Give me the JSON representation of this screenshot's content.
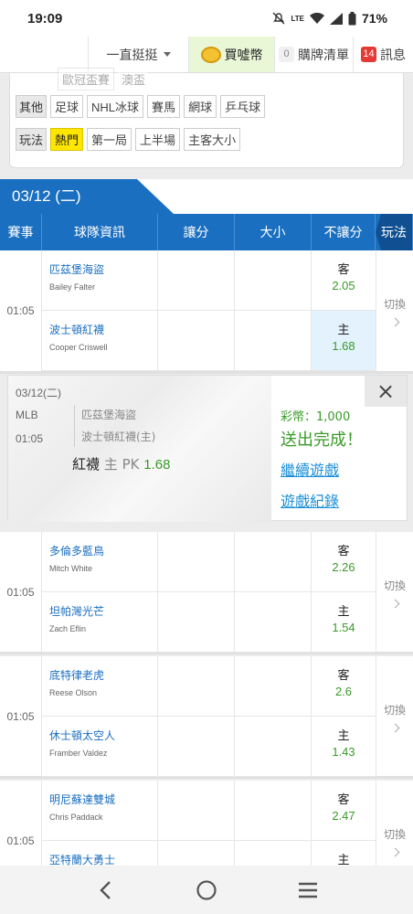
{
  "status_bar": {
    "time": "19:09",
    "battery": "71%",
    "network": "LTE"
  },
  "top_nav": {
    "select_label": "一直挺挺",
    "buy_coins_label": "買噓幣",
    "cart_count": "0",
    "cart_label": "購牌清單",
    "msg_count": "14",
    "msg_label": "訊息"
  },
  "filter": {
    "partial_row": [
      "歐冠盃賽",
      "澳盃"
    ],
    "other_label": "其他",
    "other_items": [
      "足球",
      "NHL冰球",
      "賽馬",
      "網球",
      "乒乓球"
    ],
    "play_label": "玩法",
    "play_items": [
      "熱門",
      "第一局",
      "上半場",
      "主客大小"
    ]
  },
  "date_tab": "03/12 (二)",
  "table_headers": [
    "賽事",
    "球隊資訊",
    "讓分",
    "大小",
    "不讓分",
    "玩法"
  ],
  "games": [
    {
      "time": "01:05",
      "switch": "切換",
      "away": {
        "team": "匹茲堡海盜",
        "pitcher": "Bailey Falter",
        "label": "客",
        "odds": "2.05"
      },
      "home": {
        "team": "波士頓紅襪",
        "pitcher": "Cooper Criswell",
        "label": "主",
        "odds": "1.68"
      }
    },
    {
      "time": "01:05",
      "switch": "切換",
      "away": {
        "team": "多倫多藍鳥",
        "pitcher": "Mitch White",
        "label": "客",
        "odds": "2.26"
      },
      "home": {
        "team": "坦帕灣光芒",
        "pitcher": "Zach Eflin",
        "label": "主",
        "odds": "1.54"
      }
    },
    {
      "time": "01:05",
      "switch": "切換",
      "away": {
        "team": "底特律老虎",
        "pitcher": "Reese Olson",
        "label": "客",
        "odds": "2.6"
      },
      "home": {
        "team": "休士頓太空人",
        "pitcher": "Framber Valdez",
        "label": "主",
        "odds": "1.43"
      }
    },
    {
      "time": "01:05",
      "switch": "切換",
      "away": {
        "team": "明尼蘇達雙城",
        "pitcher": "Chris Paddack",
        "label": "客",
        "odds": "2.47"
      },
      "home": {
        "team": "亞特蘭大勇士",
        "pitcher": "",
        "label": "主",
        "odds": ""
      }
    }
  ],
  "popup": {
    "date": "03/12(二)",
    "league": "MLB",
    "time": "01:05",
    "team1": "匹茲堡海盜",
    "team2": "波士頓紅襪(主)",
    "bet_team": "紅襪",
    "bet_side": "主 PK",
    "bet_odds": "1.68",
    "coins": "彩幣：1,000",
    "done": "送出完成！",
    "continue_label": "繼續遊戲",
    "history_label": "遊戲紀錄",
    "close_icon": "×"
  }
}
